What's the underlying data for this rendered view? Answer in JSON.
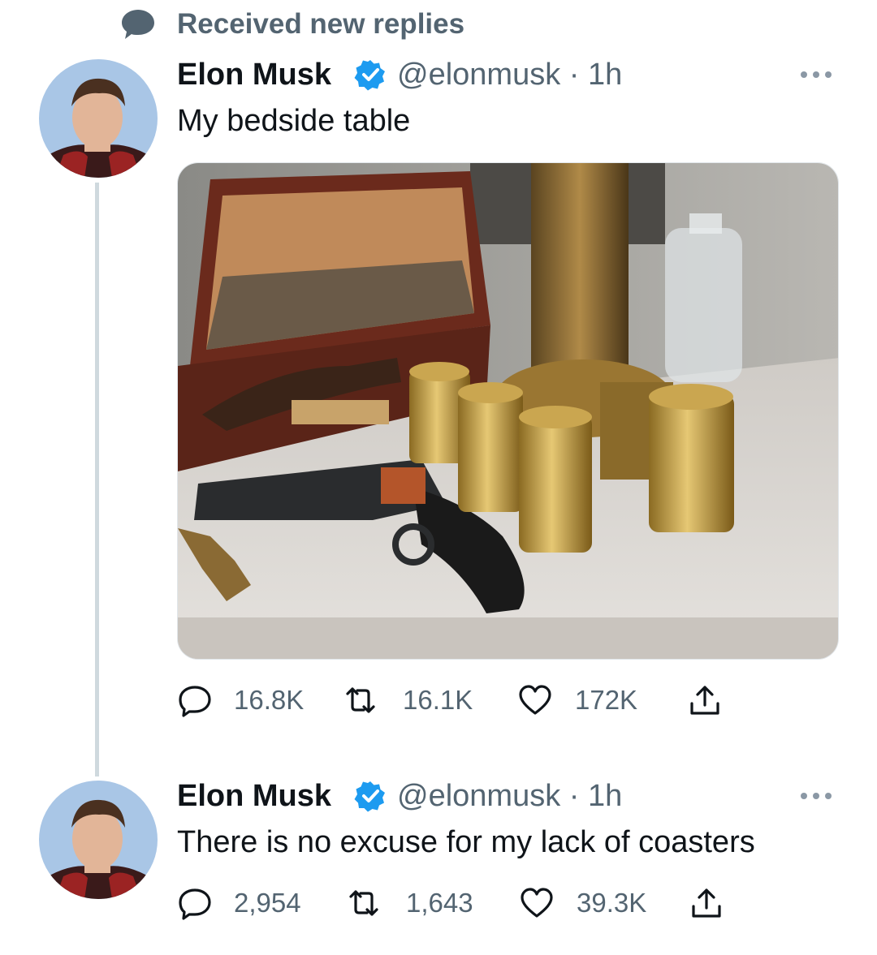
{
  "banner": {
    "text": "Received new replies",
    "icon": "speech-bubble-icon"
  },
  "colors": {
    "verified": "#1d9bf0",
    "muted": "#536471",
    "thread_line": "#cfd9de",
    "text": "#0f1419"
  },
  "tweets": [
    {
      "author": {
        "name": "Elon Musk",
        "handle": "@elonmusk",
        "time": " · 1h",
        "verified": true
      },
      "text": "My bedside table",
      "has_media": true,
      "stats": {
        "replies": "16.8K",
        "retweets": "16.1K",
        "likes": "172K"
      }
    },
    {
      "author": {
        "name": "Elon Musk",
        "handle": "@elonmusk",
        "time": " · 1h",
        "verified": true
      },
      "text": "There is no excuse for my lack of coasters",
      "has_media": false,
      "stats": {
        "replies": "2,954",
        "retweets": "1,643",
        "likes": "39.3K"
      }
    }
  ]
}
